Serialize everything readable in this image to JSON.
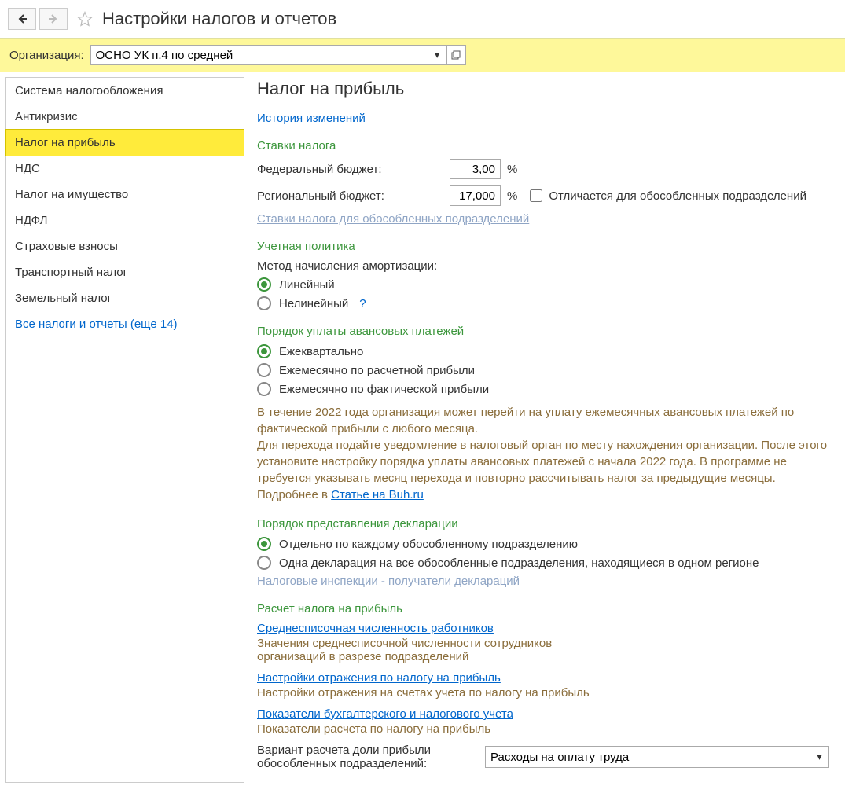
{
  "header": {
    "title": "Настройки налогов и отчетов"
  },
  "org": {
    "label": "Организация:",
    "value": "ОСНО УК п.4 по средней"
  },
  "sidebar": {
    "items": [
      "Система налогообложения",
      "Антикризис",
      "Налог на прибыль",
      "НДС",
      "Налог на имущество",
      "НДФЛ",
      "Страховые взносы",
      "Транспортный налог",
      "Земельный налог"
    ],
    "more_link": "Все налоги и отчеты (еще 14)"
  },
  "content": {
    "heading": "Налог на прибыль",
    "history_link": "История изменений",
    "rates": {
      "title": "Ставки налога",
      "federal_label": "Федеральный бюджет:",
      "federal_value": "3,00",
      "regional_label": "Региональный бюджет:",
      "regional_value": "17,000",
      "percent": "%",
      "diff_label": "Отличается для обособленных подразделений",
      "sub_link": "Ставки налога для обособленных подразделений"
    },
    "policy": {
      "title": "Учетная политика",
      "method_label": "Метод начисления амортизации:",
      "opt1": "Линейный",
      "opt2": "Нелинейный",
      "help": "?"
    },
    "advance": {
      "title": "Порядок уплаты авансовых платежей",
      "opt1": "Ежеквартально",
      "opt2": "Ежемесячно по расчетной прибыли",
      "opt3": "Ежемесячно по фактической прибыли",
      "info1": "В течение 2022 года организация может перейти на уплату ежемесячных авансовых платежей по фактической прибыли с любого месяца.",
      "info2": "Для перехода подайте уведомление в налоговый орган по месту нахождения организации. После этого установите настройку порядка уплаты авансовых платежей с начала 2022 года. В программе не требуется указывать месяц перехода и повторно рассчитывать налог за предыдущие месяцы. Подробнее в ",
      "info_link": "Статье на Buh.ru"
    },
    "decl": {
      "title": "Порядок представления декларации",
      "opt1": "Отдельно по каждому обособленному подразделению",
      "opt2": "Одна декларация на все обособленные подразделения, находящиеся в одном регионе",
      "link": "Налоговые инспекции - получатели деклараций"
    },
    "calc": {
      "title": "Расчет налога на прибыль",
      "link1": "Среднесписочная численность работников",
      "desc1": "Значения среднесписочной численности сотрудников организаций в разрезе подразделений",
      "link2": "Настройки отражения по налогу на прибыль",
      "desc2": "Настройки отражения на счетах учета по налогу на прибыль",
      "link3": "Показатели бухгалтерского и налогового учета",
      "desc3": "Показатели расчета по налогу на прибыль",
      "select_label": "Вариант расчета доли прибыли обособленных подразделений:",
      "select_value": "Расходы на оплату труда"
    }
  }
}
